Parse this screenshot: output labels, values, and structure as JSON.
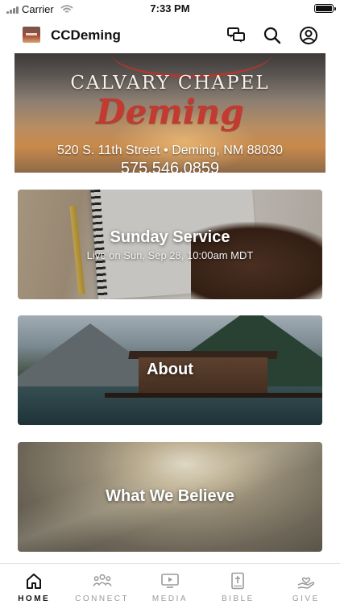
{
  "status_bar": {
    "carrier": "Carrier",
    "time": "7:33 PM"
  },
  "header": {
    "title": "CCDeming",
    "icons": [
      "chat-bubbles-icon",
      "search-icon",
      "profile-icon"
    ]
  },
  "banner": {
    "line1": "CALVARY CHAPEL",
    "line2": "Deming",
    "line3": "520 S. 11th Street • Deming, NM 88030",
    "line4": "575.546.0859"
  },
  "cards": [
    {
      "title": "Sunday Service",
      "subtitle": "Live on Sun, Sep 28, 10:00am MDT"
    },
    {
      "title": "About"
    },
    {
      "title": "What We Believe"
    }
  ],
  "tabs": [
    {
      "label": "HOME",
      "icon": "home-icon",
      "active": true
    },
    {
      "label": "CONNECT",
      "icon": "people-icon",
      "active": false
    },
    {
      "label": "MEDIA",
      "icon": "play-screen-icon",
      "active": false
    },
    {
      "label": "BIBLE",
      "icon": "bible-icon",
      "active": false
    },
    {
      "label": "GIVE",
      "icon": "giving-hand-icon",
      "active": false
    }
  ],
  "colors": {
    "active_tab": "#111111",
    "inactive_tab": "#9a9a9a",
    "banner_red": "#c33a31"
  }
}
